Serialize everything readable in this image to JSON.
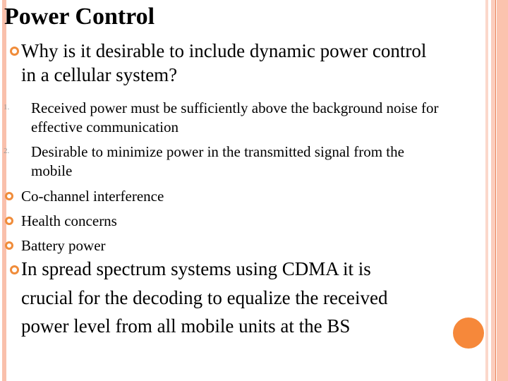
{
  "slide": {
    "title": "Power Control",
    "question": {
      "line1": "Why is it desirable to include dynamic power control",
      "line2": "in a cellular system?"
    },
    "numbered": [
      {
        "num": "1.",
        "line1": "Received power must be sufficiently above the background noise for",
        "line2": "effective communication"
      },
      {
        "num": "2.",
        "line1": "Desirable to minimize power in the transmitted signal from the",
        "line2": "mobile"
      }
    ],
    "sub_bullets": [
      "Co-channel interference",
      "Health concerns",
      "Battery power"
    ],
    "cdma": {
      "line1": "In spread spectrum systems using CDMA it is",
      "line2": "crucial for the decoding to equalize the received",
      "line3": "power level from all mobile units at the BS"
    },
    "colors": {
      "accent": "#f08c3a",
      "stripe": "#f9c0ac",
      "dot": "#f6883a"
    }
  }
}
